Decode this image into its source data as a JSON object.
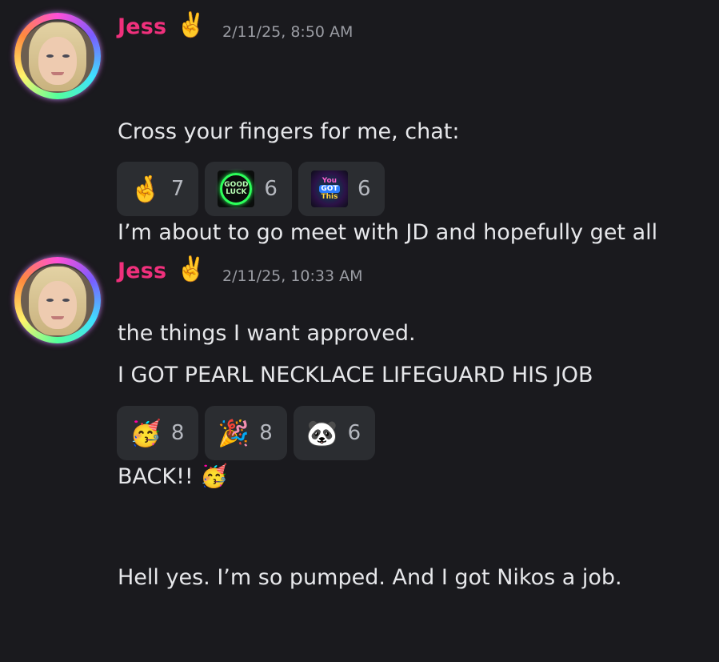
{
  "messages": [
    {
      "username": "Jess",
      "badge_icon": "victory-hand-emoji",
      "badge_glyph": "✌️",
      "timestamp": "2/11/25, 8:50 AM",
      "lines": [
        "Cross your fingers for me, chat:",
        "I’m about to go meet with JD and hopefully get all",
        "the things I want approved."
      ],
      "reactions": [
        {
          "icon": "crossed-fingers-emoji",
          "glyph": "🤞",
          "count": "7"
        },
        {
          "icon": "good-luck-sticker",
          "sticker_text": "GOOD LUCK",
          "count": "6"
        },
        {
          "icon": "you-got-this-sticker",
          "sticker_text": [
            "You",
            "GOT",
            "This"
          ],
          "count": "6"
        }
      ]
    },
    {
      "username": "Jess",
      "badge_icon": "victory-hand-emoji",
      "badge_glyph": "✌️",
      "timestamp": "2/11/25, 10:33 AM",
      "line1": "I GOT PEARL NECKLACE LIFEGUARD HIS JOB",
      "line2": "BACK!! ",
      "line2_emoji": "🥳",
      "line3": "Hell yes. I’m so pumped. And I got Nikos a job.",
      "reactions": [
        {
          "icon": "partying-face-emoji",
          "glyph": "🥳",
          "count": "8"
        },
        {
          "icon": "party-popper-emoji",
          "glyph": "🎉",
          "count": "8"
        },
        {
          "icon": "panda-party-sticker",
          "glyph": "🐼",
          "count": "6"
        }
      ]
    }
  ],
  "colors": {
    "background": "#1a1a1e",
    "username": "#f0307c",
    "reaction_bg": "#2b2d31",
    "timestamp": "#9a9ca3"
  }
}
